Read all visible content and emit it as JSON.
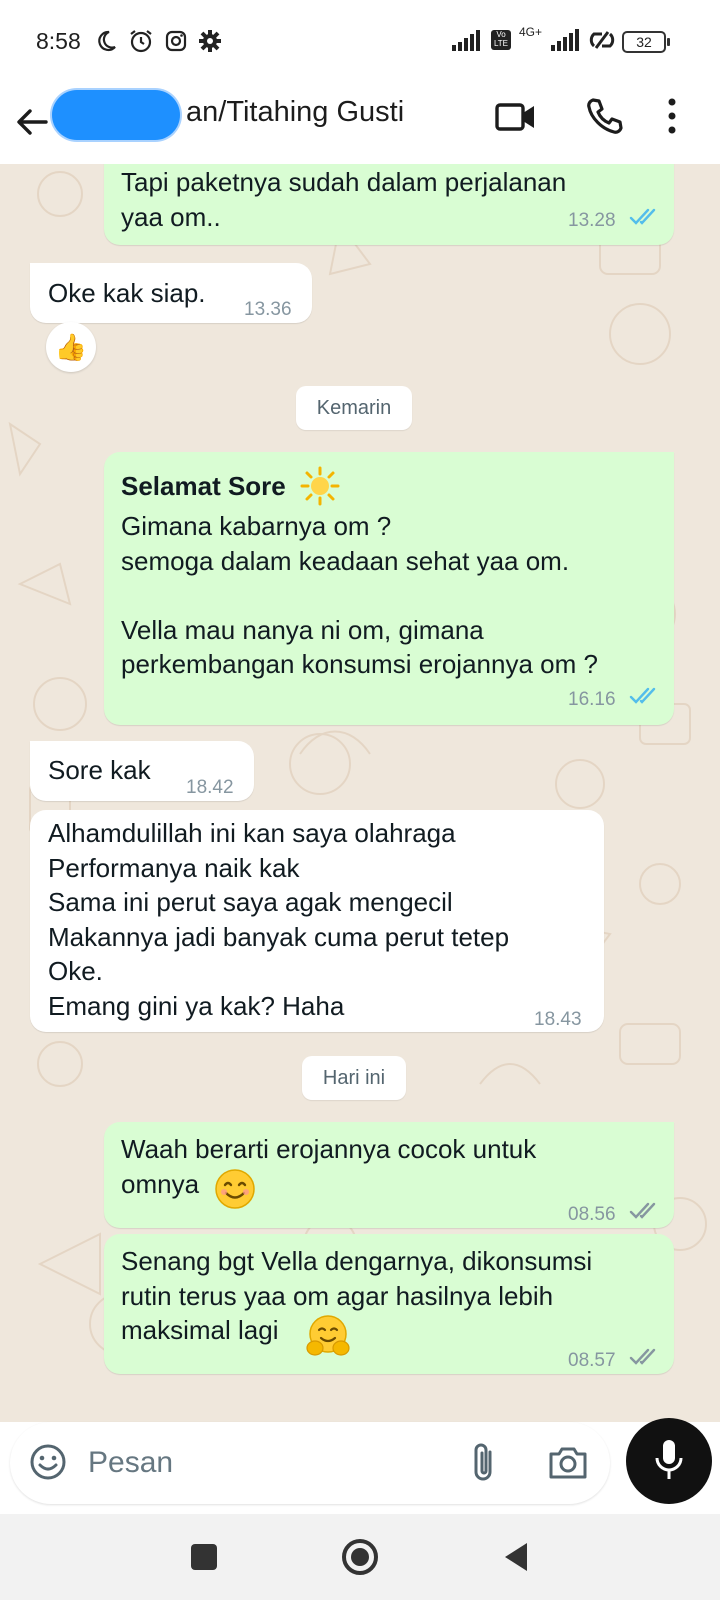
{
  "status_bar": {
    "time": "8:58",
    "network": "4G+",
    "volte": "Vo LTE",
    "battery": "32"
  },
  "header": {
    "contact_name": "an/Titahing Gusti"
  },
  "messages": [
    {
      "direction": "out",
      "text": "Tapi paketnya sudah dalam perjalanan\nyaa om..",
      "time": "13.28",
      "status": "read"
    },
    {
      "direction": "in",
      "text": "Oke kak siap.",
      "time": "13.36",
      "reaction": "👍"
    },
    {
      "direction": "out",
      "title": "Selamat Sore",
      "title_emoji": "sun",
      "text": "Gimana kabarnya om ?\nsemoga dalam keadaan sehat yaa om.\n\nVella mau nanya ni om, gimana\nperkembangan konsumsi erojannya om ?",
      "time": "16.16",
      "status": "read"
    },
    {
      "direction": "in",
      "text": "Sore kak",
      "time": "18.42"
    },
    {
      "direction": "in",
      "text": "Alhamdulillah ini kan saya olahraga\nPerformanya naik kak\nSama ini perut saya agak mengecil\nMakannya jadi banyak cuma perut tetep\nOke.\nEmang gini ya kak? Haha",
      "time": "18.43"
    },
    {
      "direction": "out",
      "text": "Waah berarti erojannya cocok untuk\nomnya",
      "emoji": "smiling-face",
      "time": "08.56",
      "status": "delivered"
    },
    {
      "direction": "out",
      "text": "Senang bgt Vella dengarnya, dikonsumsi\nrutin terus yaa om agar hasilnya lebih\nmaksimal lagi",
      "emoji": "hugging-face",
      "time": "08.57",
      "status": "delivered"
    }
  ],
  "date_separators": [
    "Kemarin",
    "Hari ini"
  ],
  "input": {
    "placeholder": "Pesan"
  },
  "colors": {
    "outgoing_bubble": "#d9fdd3",
    "incoming_bubble": "#ffffff",
    "read_ticks": "#53bdeb",
    "delivered_ticks": "#8696a0",
    "chat_background": "#efe7dc"
  }
}
